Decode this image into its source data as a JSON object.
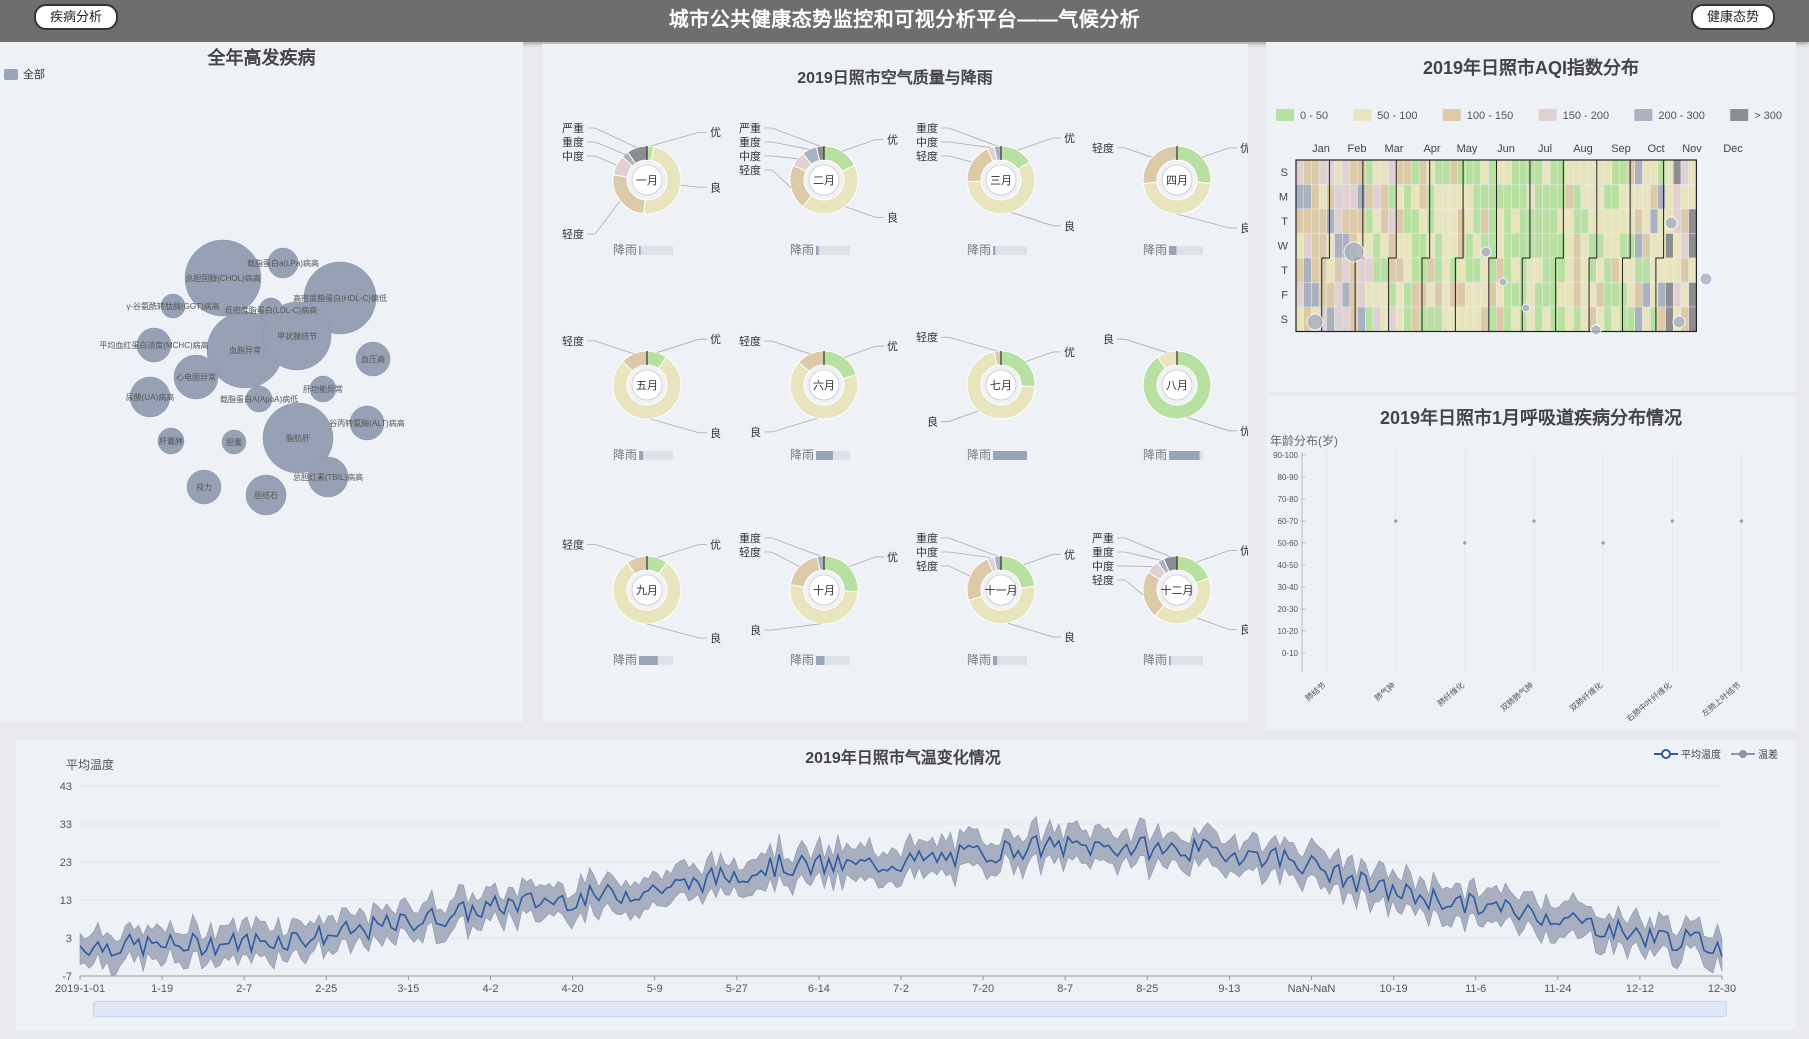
{
  "topbar": {
    "title": "城市公共健康态势监控和可视分析平台——气候分析",
    "left_button": "疾病分析",
    "right_button": "健康态势"
  },
  "disease_panel": {
    "title": "全年高发疾病",
    "legend_label": "全部",
    "bubbles": [
      {
        "label": "总胆固醇(CHOL)病高",
        "r": 38
      },
      {
        "label": "高密度脂蛋白(HDL-C)偏低",
        "r": 36
      },
      {
        "label": "血脂异常",
        "r": 38
      },
      {
        "label": "尿酸(UA)病高",
        "r": 20
      },
      {
        "label": "甲状腺结节",
        "r": 34
      },
      {
        "label": "脂肪肝",
        "r": 35
      },
      {
        "label": "载脂蛋白a(LPa)病高",
        "r": 15
      },
      {
        "label": "γ-谷氨酰转肽酶(GGT)病高",
        "r": 12
      },
      {
        "label": "低密度脂蛋白(LDL-C)病高",
        "r": 12
      },
      {
        "label": "平均血红蛋白浓度(MCHC)病高",
        "r": 17
      },
      {
        "label": "心电图异常",
        "r": 22
      },
      {
        "label": "血压高",
        "r": 17
      },
      {
        "label": "载脂蛋白A(ApoA)病低",
        "r": 13
      },
      {
        "label": "肝功能异常",
        "r": 13
      },
      {
        "label": "谷丙转氨酶(ALT)病高",
        "r": 17
      },
      {
        "label": "肝囊肿",
        "r": 13
      },
      {
        "label": "胆囊",
        "r": 12
      },
      {
        "label": "总胆红素(TBIL)病高",
        "r": 20
      },
      {
        "label": "视力",
        "r": 17
      },
      {
        "label": "胆结石",
        "r": 20
      }
    ]
  },
  "air_panel": {
    "title": "2019日照市空气质量与降雨",
    "rain_label": "降雨",
    "months": [
      {
        "name": "一月",
        "values": {
          "优": 1,
          "良": 15,
          "轻度": 8,
          "中度": 3,
          "重度": 1,
          "严重": 3
        },
        "rain": 0.05
      },
      {
        "name": "二月",
        "values": {
          "优": 5,
          "良": 12,
          "轻度": 6,
          "中度": 2,
          "重度": 2,
          "严重": 1
        },
        "rain": 0.08
      },
      {
        "name": "三月",
        "values": {
          "优": 5,
          "良": 18,
          "轻度": 6,
          "中度": 1,
          "重度": 1,
          "严重": 0
        },
        "rain": 0.07
      },
      {
        "name": "四月",
        "values": {
          "优": 8,
          "良": 14,
          "轻度": 8,
          "中度": 0,
          "重度": 0,
          "严重": 0
        },
        "rain": 0.22
      },
      {
        "name": "五月",
        "values": {
          "优": 3,
          "良": 24,
          "轻度": 4,
          "中度": 0,
          "重度": 0,
          "严重": 0
        },
        "rain": 0.12
      },
      {
        "name": "六月",
        "values": {
          "优": 6,
          "良": 20,
          "轻度": 4,
          "中度": 0,
          "重度": 0,
          "严重": 0
        },
        "rain": 0.5
      },
      {
        "name": "七月",
        "values": {
          "优": 8,
          "良": 22,
          "轻度": 1,
          "中度": 0,
          "重度": 0,
          "严重": 0
        },
        "rain": 1.0
      },
      {
        "name": "八月",
        "values": {
          "优": 28,
          "良": 3,
          "轻度": 0,
          "中度": 0,
          "重度": 0,
          "严重": 0
        },
        "rain": 0.9
      },
      {
        "name": "九月",
        "values": {
          "优": 3,
          "良": 24,
          "轻度": 3,
          "中度": 0,
          "重度": 0,
          "严重": 0
        },
        "rain": 0.55
      },
      {
        "name": "十月",
        "values": {
          "优": 8,
          "良": 16,
          "轻度": 6,
          "中度": 0,
          "重度": 1,
          "严重": 0
        },
        "rain": 0.25
      },
      {
        "name": "十一月",
        "values": {
          "优": 7,
          "良": 14,
          "轻度": 7,
          "中度": 1,
          "重度": 1,
          "严重": 0
        },
        "rain": 0.12
      },
      {
        "name": "十二月",
        "values": {
          "优": 6,
          "良": 13,
          "轻度": 7,
          "中度": 2,
          "重度": 1,
          "严重": 2
        },
        "rain": 0.05
      }
    ],
    "level_colors": {
      "优": "#b8e0a0",
      "良": "#e8e4be",
      "轻度": "#dcc9a8",
      "中度": "#e0d0d2",
      "重度": "#aab2c2",
      "严重": "#8c8e92"
    }
  },
  "aqi_panel": {
    "title": "2019年日照市AQI指数分布",
    "legend": [
      {
        "label": "0 - 50",
        "color": "#b8e0a0"
      },
      {
        "label": "50 - 100",
        "color": "#e8e4be"
      },
      {
        "label": "100 - 150",
        "color": "#dcc9a8"
      },
      {
        "label": "150 - 200",
        "color": "#e0d0d2"
      },
      {
        "label": "200 - 300",
        "color": "#aab2c2"
      },
      {
        "label": "> 300",
        "color": "#8c8e92"
      }
    ],
    "months": [
      "Jan",
      "Feb",
      "Mar",
      "Apr",
      "May",
      "Jun",
      "Jul",
      "Aug",
      "Sep",
      "Oct",
      "Nov",
      "Dec"
    ],
    "weekdays": [
      "S",
      "M",
      "T",
      "W",
      "T",
      "F",
      "S"
    ]
  },
  "resp_panel": {
    "title": "2019年日照市1月呼吸道疾病分布情况",
    "ylabel": "年龄分布(岁)",
    "yticks": [
      "0-10",
      "10-20",
      "20-30",
      "30-40",
      "40-50",
      "50-60",
      "60-70",
      "70-80",
      "80-90",
      "90-100"
    ],
    "categories": [
      "肺结节",
      "肺气肿",
      "肺纤维化",
      "双肺肺气肿",
      "双肺纤维化",
      "右肺中叶纤维化",
      "左肺上叶结节"
    ],
    "points": [
      6,
      5,
      6,
      5,
      6,
      6
    ]
  },
  "temp_panel": {
    "title": "2019年日照市气温变化情况",
    "ylabel": "平均温度",
    "legend_avg": "平均温度",
    "legend_range": "温差",
    "yticks": [
      "43",
      "33",
      "23",
      "13",
      "3",
      "-7"
    ],
    "xticks": [
      "2019-1-01",
      "1-19",
      "2-7",
      "2-25",
      "3-15",
      "4-2",
      "4-20",
      "5-9",
      "5-27",
      "6-14",
      "7-2",
      "7-20",
      "8-7",
      "8-25",
      "9-13",
      "NaN-NaN",
      "10-19",
      "11-6",
      "11-24",
      "12-12",
      "12-30"
    ]
  },
  "chart_data": [
    {
      "type": "line",
      "title": "2019年日照市气温变化情况",
      "ylabel": "平均温度",
      "ylim": [
        -7,
        43
      ],
      "series": [
        {
          "name": "平均温度",
          "x": [
            "1-01",
            "1-19",
            "2-7",
            "2-25",
            "3-15",
            "4-2",
            "4-20",
            "5-9",
            "5-27",
            "6-14",
            "7-2",
            "7-20",
            "8-7",
            "8-25",
            "9-13",
            "10-19",
            "11-6",
            "11-24",
            "12-12",
            "12-30"
          ],
          "values": [
            1,
            1,
            2,
            4,
            8,
            12,
            14,
            17,
            22,
            22,
            24,
            27,
            27,
            26,
            24,
            16,
            12,
            9,
            4,
            1
          ]
        }
      ]
    }
  ]
}
